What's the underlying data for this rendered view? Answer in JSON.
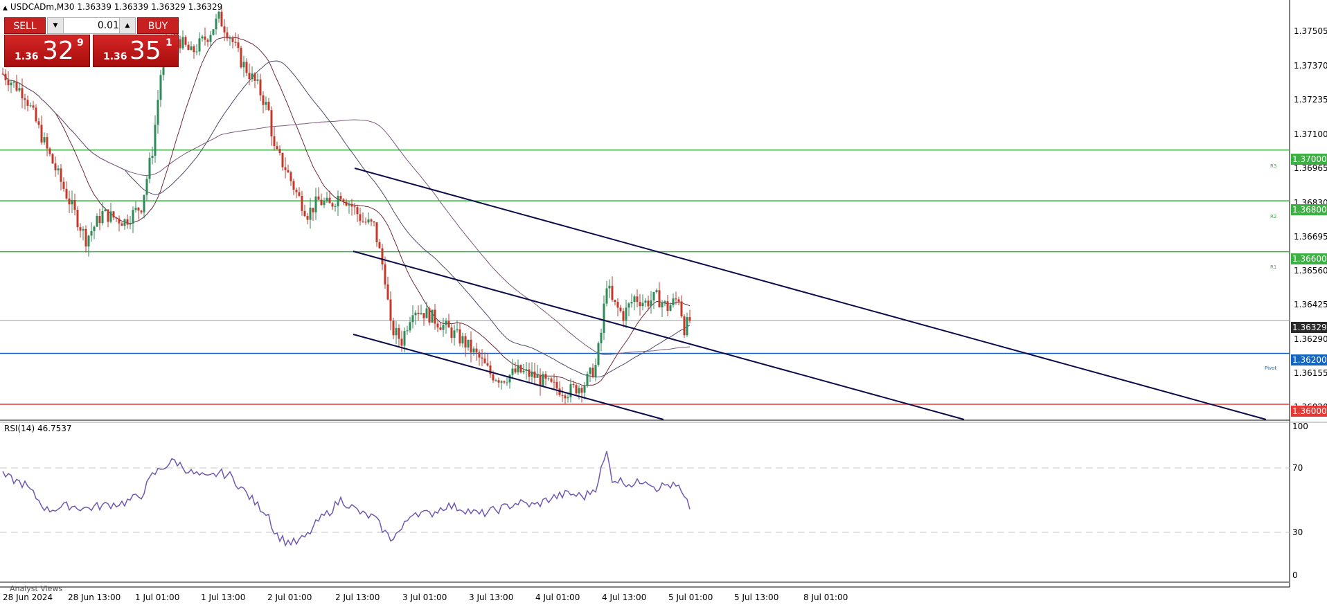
{
  "window": {
    "header_arrow": "▲",
    "title_text": "USDCADm,M30  1.36339 1.36339 1.36329 1.36329"
  },
  "trade_panel": {
    "sell_label": "SELL",
    "buy_label": "BUY",
    "lot_value": "0.01",
    "sell_price": {
      "small": "1.36",
      "big": "32",
      "sup": "9"
    },
    "buy_price": {
      "small": "1.36",
      "big": "35",
      "sup": "1"
    }
  },
  "colors": {
    "bull": "#2e8b57",
    "bear": "#c0392b",
    "channel": "#0c0c4a",
    "resistance": "#3cb043",
    "pivot": "#1565c0",
    "support": "#e53935",
    "rsi_line": "#7058b0"
  },
  "price_axis": {
    "ticks": [
      "1.37505",
      "1.37370",
      "1.37235",
      "1.37100",
      "1.36965",
      "1.36830",
      "1.36695",
      "1.36560",
      "1.36425",
      "1.36290",
      "1.36155",
      "1.36020"
    ]
  },
  "levels": [
    {
      "id": "r3",
      "price": "1.37000",
      "name": "R3"
    },
    {
      "id": "r2",
      "price": "1.36800",
      "name": "R2"
    },
    {
      "id": "r1",
      "price": "1.36600",
      "name": "R1"
    },
    {
      "id": "current",
      "price": "1.36329"
    },
    {
      "id": "pivot",
      "price": "1.36200",
      "name": "Pivot"
    },
    {
      "id": "support",
      "price": "1.36000"
    }
  ],
  "rsi": {
    "label": "RSI(14) 46.7537",
    "scale": [
      "100",
      "70",
      "30",
      "0"
    ],
    "levels": [
      70,
      30
    ]
  },
  "time_axis": {
    "labels": [
      "28 Jun 2024",
      "28 Jun 13:00",
      "1 Jul 01:00",
      "1 Jul 13:00",
      "2 Jul 01:00",
      "2 Jul 13:00",
      "3 Jul 01:00",
      "3 Jul 13:00",
      "4 Jul 01:00",
      "4 Jul 13:00",
      "5 Jul 01:00",
      "5 Jul 13:00",
      "8 Jul 01:00"
    ]
  },
  "bottom_tab": "Analyst Views",
  "chart_data": {
    "type": "candlestick",
    "symbol": "USDCADm",
    "timeframe": "M30",
    "ylim": [
      1.3594,
      1.3759
    ],
    "price_anchors": [
      [
        0,
        1.373
      ],
      [
        8,
        1.3722
      ],
      [
        16,
        1.37
      ],
      [
        24,
        1.368
      ],
      [
        30,
        1.3665
      ],
      [
        36,
        1.3675
      ],
      [
        44,
        1.3672
      ],
      [
        50,
        1.3678
      ],
      [
        54,
        1.37
      ],
      [
        58,
        1.374
      ],
      [
        62,
        1.3745
      ],
      [
        68,
        1.3738
      ],
      [
        74,
        1.3745
      ],
      [
        78,
        1.3752
      ],
      [
        82,
        1.3745
      ],
      [
        86,
        1.3735
      ],
      [
        92,
        1.3725
      ],
      [
        96,
        1.3715
      ],
      [
        98,
        1.37
      ],
      [
        102,
        1.3693
      ],
      [
        106,
        1.3683
      ],
      [
        110,
        1.3675
      ],
      [
        114,
        1.368
      ],
      [
        118,
        1.3678
      ],
      [
        122,
        1.3683
      ],
      [
        126,
        1.3678
      ],
      [
        130,
        1.3672
      ],
      [
        134,
        1.367
      ],
      [
        138,
        1.365
      ],
      [
        140,
        1.363
      ],
      [
        144,
        1.3625
      ],
      [
        148,
        1.3638
      ],
      [
        154,
        1.3635
      ],
      [
        160,
        1.363
      ],
      [
        166,
        1.3625
      ],
      [
        172,
        1.3618
      ],
      [
        176,
        1.3612
      ],
      [
        180,
        1.361
      ],
      [
        186,
        1.3613
      ],
      [
        192,
        1.3611
      ],
      [
        198,
        1.3607
      ],
      [
        204,
        1.3605
      ],
      [
        210,
        1.3608
      ],
      [
        214,
        1.3615
      ],
      [
        216,
        1.3628
      ],
      [
        218,
        1.3648
      ],
      [
        220,
        1.364
      ],
      [
        224,
        1.3635
      ],
      [
        228,
        1.3642
      ],
      [
        232,
        1.364
      ],
      [
        236,
        1.3642
      ],
      [
        240,
        1.3638
      ],
      [
        244,
        1.3642
      ],
      [
        246,
        1.363
      ],
      [
        248,
        1.3633
      ]
    ],
    "rsi_anchors": [
      [
        0,
        68
      ],
      [
        8,
        62
      ],
      [
        16,
        45
      ],
      [
        24,
        48
      ],
      [
        30,
        46
      ],
      [
        36,
        48
      ],
      [
        44,
        50
      ],
      [
        50,
        55
      ],
      [
        54,
        68
      ],
      [
        58,
        74
      ],
      [
        62,
        78
      ],
      [
        68,
        70
      ],
      [
        74,
        66
      ],
      [
        78,
        70
      ],
      [
        82,
        68
      ],
      [
        86,
        60
      ],
      [
        92,
        48
      ],
      [
        96,
        42
      ],
      [
        98,
        30
      ],
      [
        102,
        24
      ],
      [
        106,
        23
      ],
      [
        110,
        28
      ],
      [
        114,
        38
      ],
      [
        118,
        44
      ],
      [
        122,
        52
      ],
      [
        126,
        47
      ],
      [
        130,
        42
      ],
      [
        134,
        40
      ],
      [
        138,
        30
      ],
      [
        140,
        26
      ],
      [
        144,
        32
      ],
      [
        148,
        44
      ],
      [
        154,
        42
      ],
      [
        160,
        48
      ],
      [
        166,
        46
      ],
      [
        172,
        42
      ],
      [
        176,
        44
      ],
      [
        180,
        46
      ],
      [
        186,
        50
      ],
      [
        192,
        48
      ],
      [
        198,
        53
      ],
      [
        204,
        56
      ],
      [
        210,
        54
      ],
      [
        214,
        60
      ],
      [
        216,
        72
      ],
      [
        218,
        83
      ],
      [
        220,
        66
      ],
      [
        224,
        64
      ],
      [
        228,
        62
      ],
      [
        232,
        66
      ],
      [
        236,
        60
      ],
      [
        240,
        62
      ],
      [
        244,
        60
      ],
      [
        246,
        52
      ],
      [
        248,
        47
      ]
    ]
  }
}
